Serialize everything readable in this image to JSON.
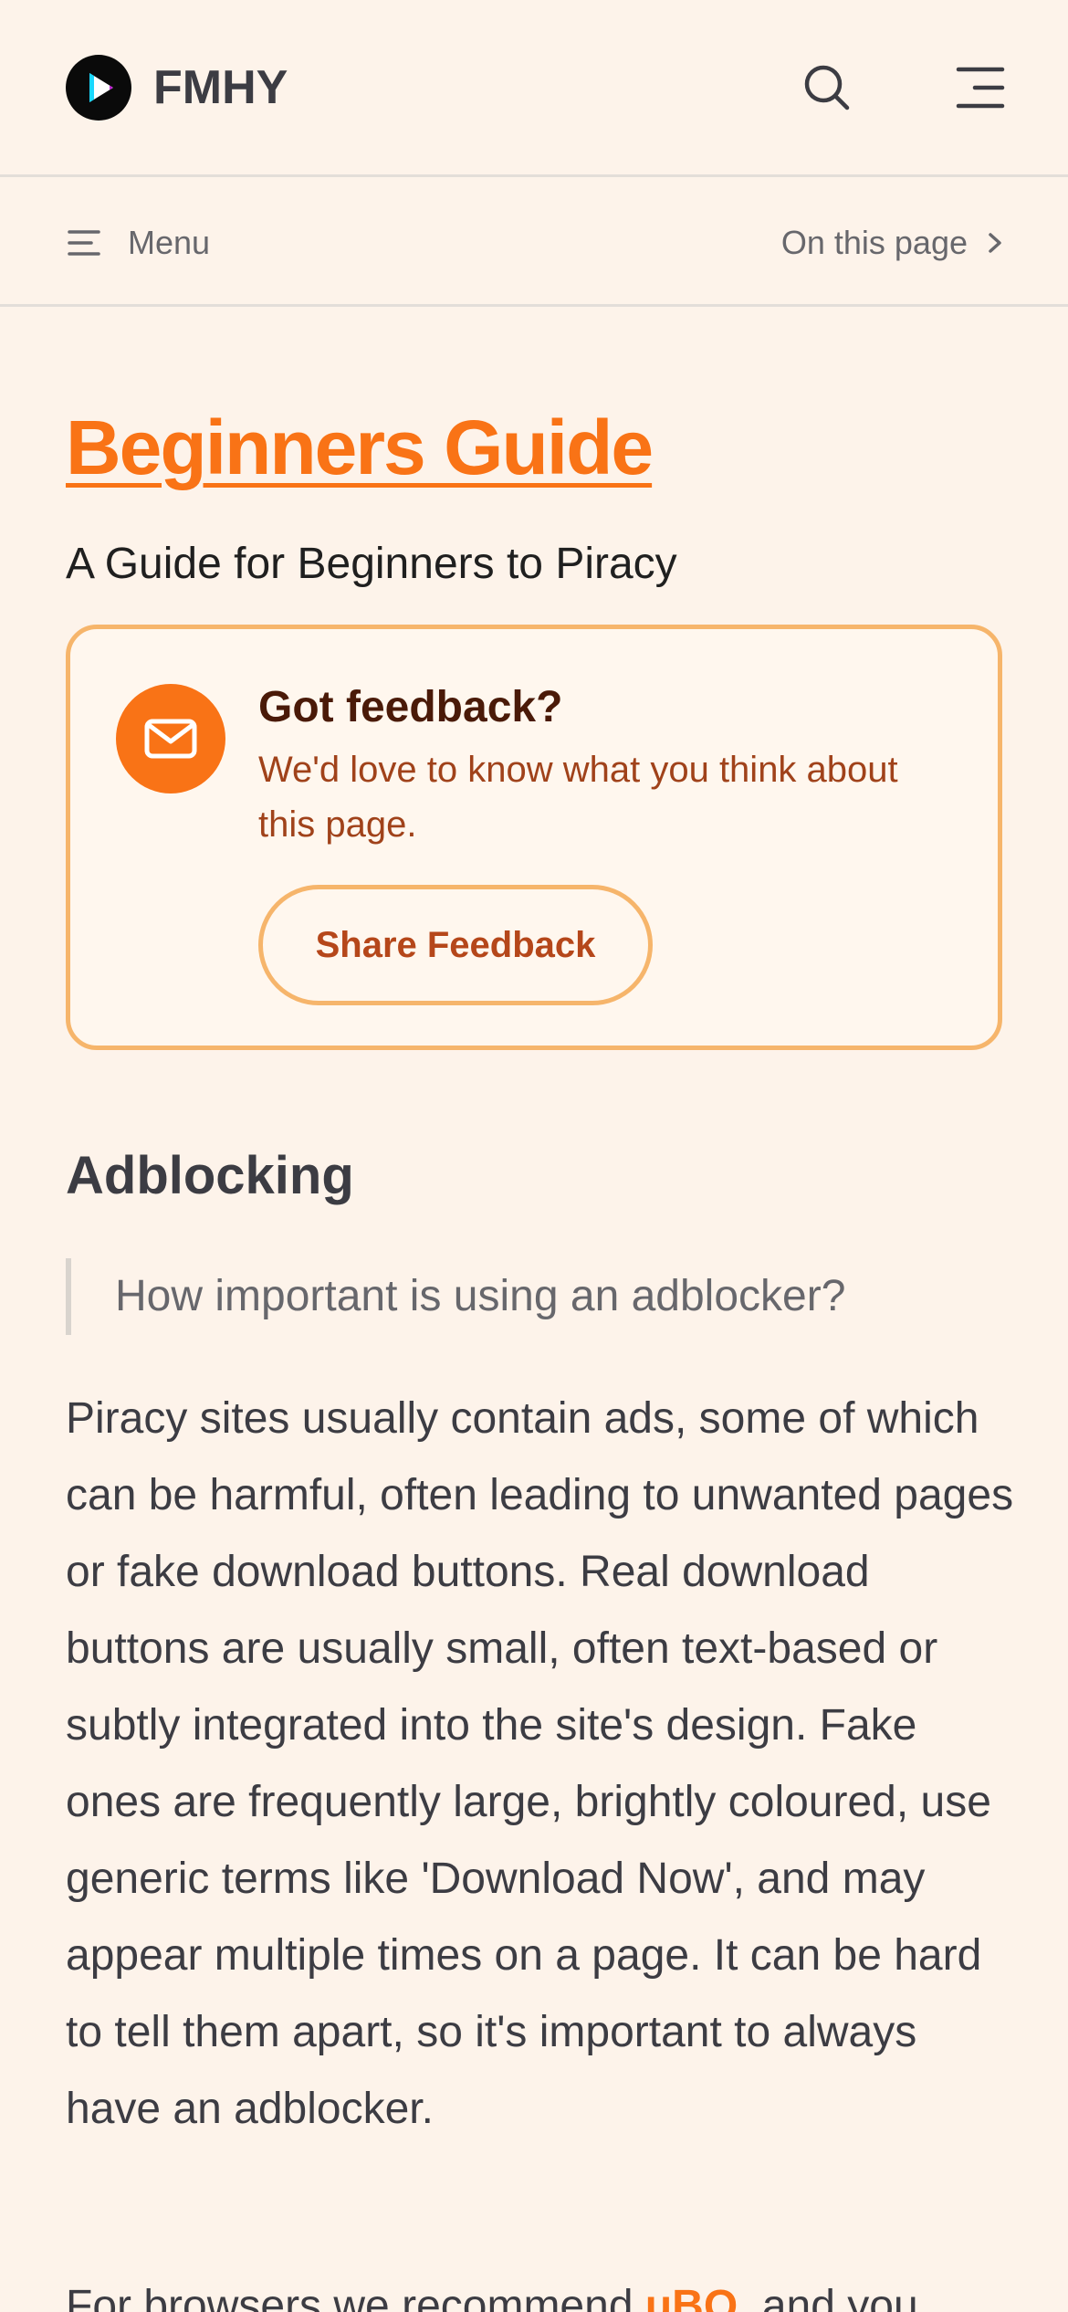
{
  "header": {
    "brand": "FMHY",
    "logo_icon": "play-logo-icon",
    "search_icon": "search-icon",
    "nav_icon": "hamburger-menu-icon"
  },
  "subnav": {
    "menu_label": "Menu",
    "on_this_page_label": "On this page"
  },
  "page": {
    "title": "Beginners Guide",
    "subtitle": "A Guide for Beginners to Piracy"
  },
  "feedback": {
    "heading": "Got feedback?",
    "text": "We'd love to know what you think about this page.",
    "button_label": "Share Feedback",
    "icon": "mail-icon"
  },
  "section": {
    "heading": "Adblocking",
    "quote": "How important is using an adblocker?",
    "paragraph": "Piracy sites usually contain ads, some of which can be harmful, often leading to unwanted pages or fake download buttons. Real download buttons are usually small, often text-based or subtly integrated into the site's design. Fake ones are frequently large, brightly coloured, use generic terms like 'Download Now', and may appear multiple times on a page. It can be hard to tell them apart, so it's important to always have an adblocker.",
    "paragraph2_start": "For browsers we recommend ",
    "paragraph2_link": "uBO",
    "paragraph2_end": ", and you"
  },
  "colors": {
    "accent": "#f97316",
    "background": "#fdf3ea",
    "feedback_border": "#f6b56b"
  }
}
